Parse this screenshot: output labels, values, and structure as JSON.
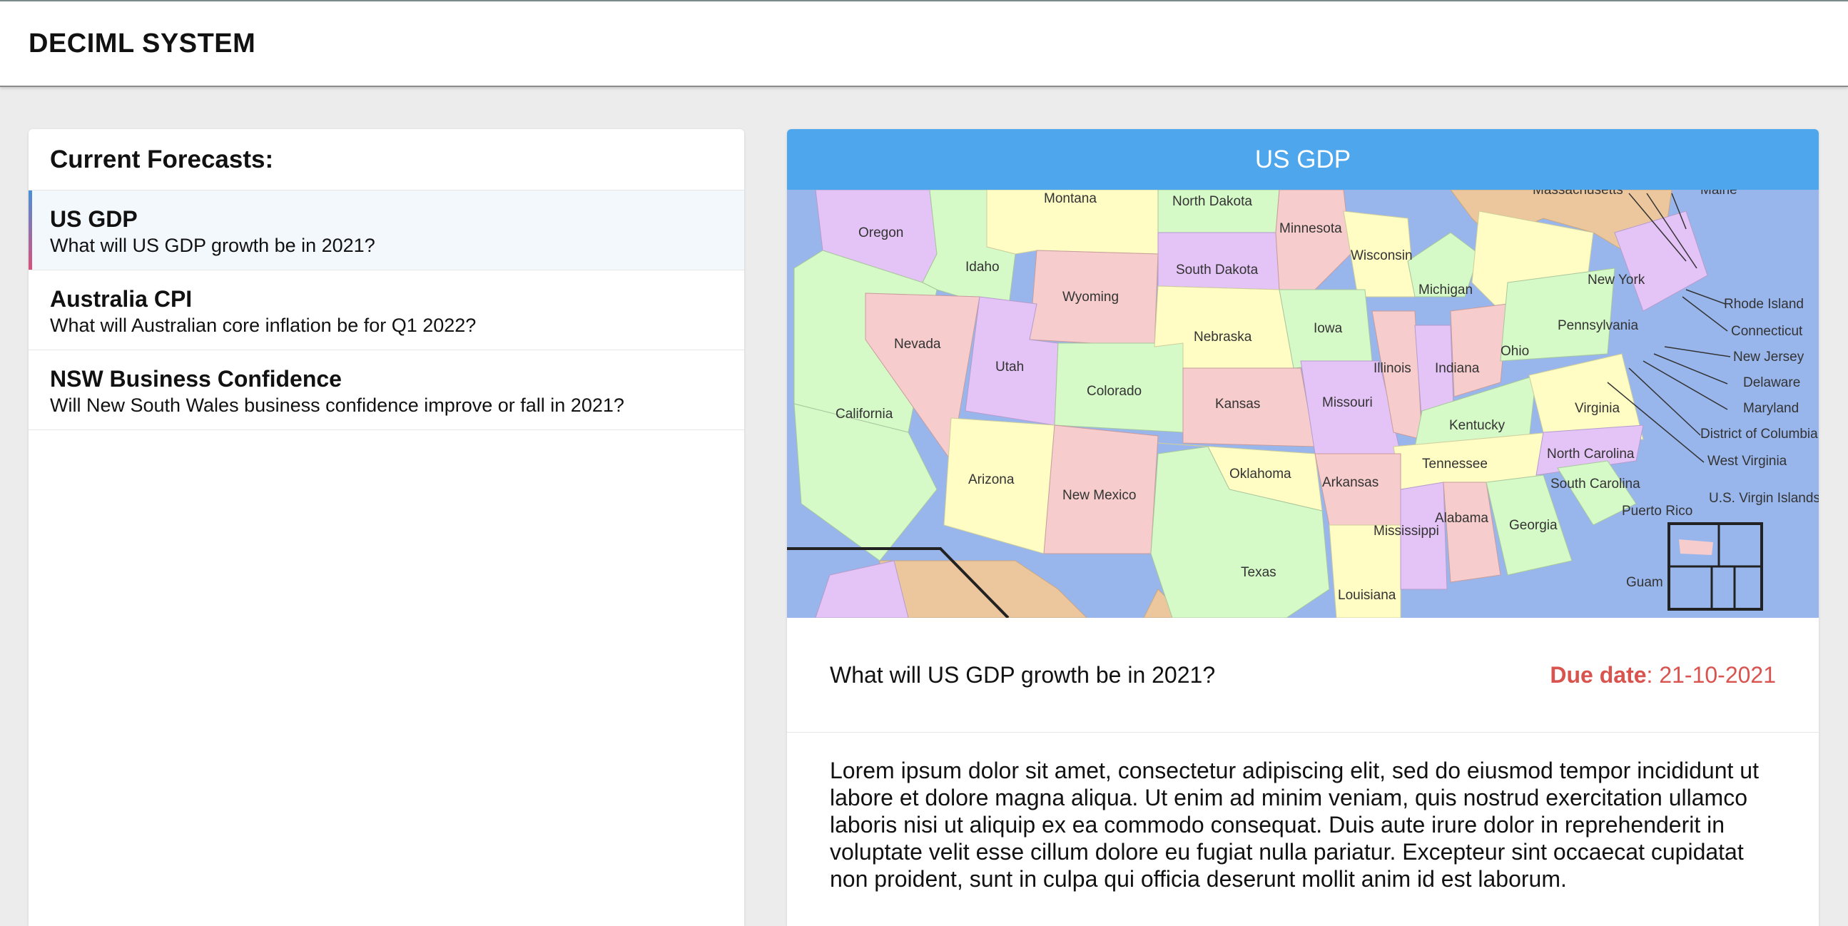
{
  "app": {
    "title": "DECIML SYSTEM"
  },
  "sidebar": {
    "title": "Current Forecasts:",
    "items": [
      {
        "title": "US GDP",
        "question": "What will US GDP growth be in 2021?"
      },
      {
        "title": "Australia CPI",
        "question": "What will Australian core inflation be for Q1 2022?"
      },
      {
        "title": "NSW Business Confidence",
        "question": "Will New South Wales business confidence improve or fall in 2021?"
      }
    ]
  },
  "detail": {
    "header": "US GDP",
    "question": "What will US GDP growth be in 2021?",
    "due_label": "Due date",
    "due_value": ": 21-10-2021",
    "body": "Lorem ipsum dolor sit amet, consectetur adipiscing elit, sed do eiusmod tempor incididunt ut labore et dolore magna aliqua. Ut enim ad minim veniam, quis nostrud exercitation ullamco laboris nisi ut aliquip ex ea commodo consequat. Duis aute irure dolor in reprehenderit in voluptate velit esse cillum dolore eu fugiat nulla pariatur. Excepteur sint occaecat cupidatat non proident, sunt in culpa qui officia deserunt mollit anim id est laborum."
  },
  "map": {
    "states": [
      "Oregon",
      "Montana",
      "North Dakota",
      "Minnesota",
      "Massachusetts",
      "Maine",
      "Idaho",
      "South Dakota",
      "Wisconsin",
      "Michigan",
      "New York",
      "Rhode Island",
      "Connecticut",
      "New Jersey",
      "Delaware",
      "Maryland",
      "District of Columbia",
      "West Virginia",
      "Wyoming",
      "Nevada",
      "Nebraska",
      "Iowa",
      "Pennsylvania",
      "Ohio",
      "Illinois",
      "Indiana",
      "Utah",
      "Colorado",
      "Kansas",
      "Missouri",
      "Virginia",
      "Kentucky",
      "California",
      "Tennessee",
      "North Carolina",
      "Oklahoma",
      "Arizona",
      "New Mexico",
      "Arkansas",
      "South Carolina",
      "U.S. Virgin Islands",
      "Puerto Rico",
      "Alabama",
      "Georgia",
      "Mississippi",
      "Texas",
      "Guam",
      "Louisiana"
    ]
  },
  "colors": {
    "accent": "#4ea6ec",
    "due": "#d9534f",
    "active_bg": "#f3f8fd"
  }
}
